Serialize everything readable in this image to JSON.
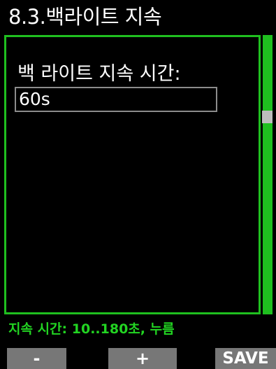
{
  "title": "8.3.백라이트 지속",
  "setting": {
    "label": "백 라이트 지속 시간:",
    "value": "60s"
  },
  "hint": "지속 시간: 10..180초, 누름",
  "softkeys": {
    "minus": "-",
    "plus": "+",
    "save": "SAVE"
  },
  "scrollbar": {
    "position_fraction": 0.3
  },
  "colors": {
    "accent": "#1fbf1f",
    "hint": "#22d422",
    "background": "#000000",
    "softkey": "#777777"
  }
}
